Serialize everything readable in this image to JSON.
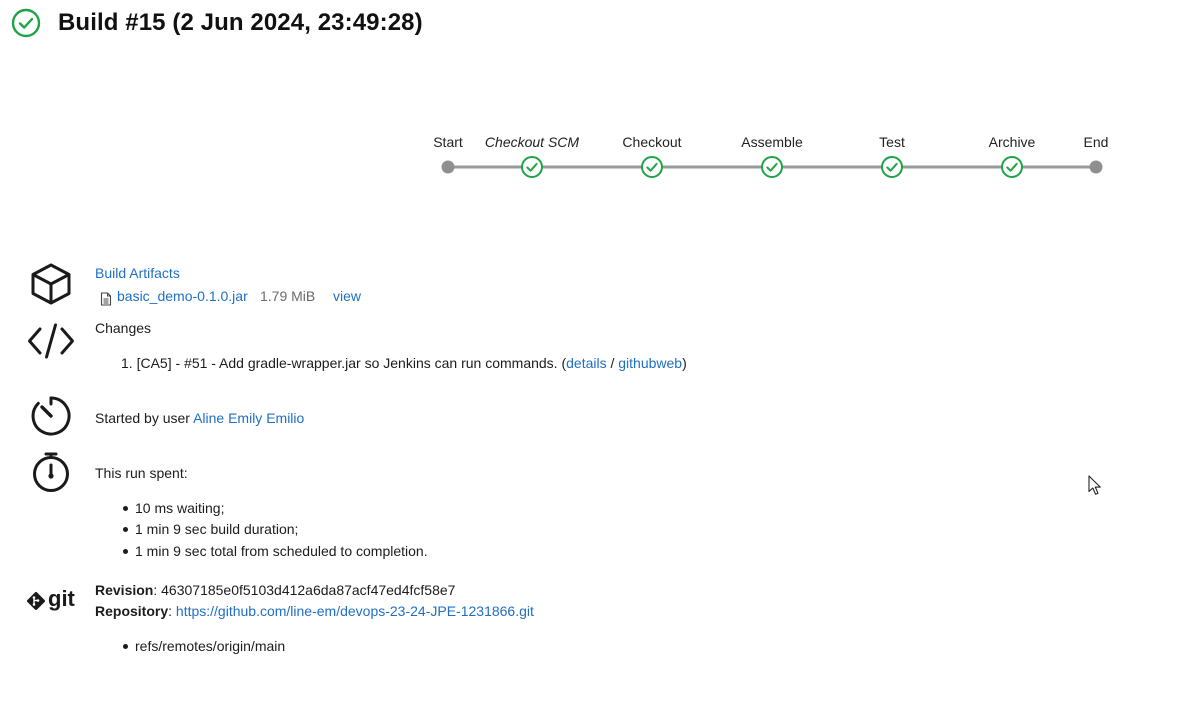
{
  "header": {
    "title": "Build #15 (2 Jun 2024, 23:49:28)",
    "status": "success",
    "status_icon": "check-circle-icon",
    "success_color": "#1ea446"
  },
  "pipeline": {
    "stages": [
      {
        "label": "Start",
        "type": "terminal",
        "italic": false
      },
      {
        "label": "Checkout SCM",
        "type": "success",
        "italic": true
      },
      {
        "label": "Checkout",
        "type": "success",
        "italic": false
      },
      {
        "label": "Assemble",
        "type": "success",
        "italic": false
      },
      {
        "label": "Test",
        "type": "success",
        "italic": false
      },
      {
        "label": "Archive",
        "type": "success",
        "italic": false
      },
      {
        "label": "End",
        "type": "terminal",
        "italic": false
      }
    ]
  },
  "artifacts": {
    "icon": "package-icon",
    "title": "Build Artifacts",
    "files": [
      {
        "name": "basic_demo-0.1.0.jar",
        "size": "1.79 MiB",
        "view_label": "view",
        "icon": "file-icon"
      }
    ]
  },
  "changes": {
    "icon": "code-icon",
    "title": "Changes",
    "items": [
      {
        "number": "1.",
        "text": "[CA5] - #51 - Add gradle-wrapper.jar so Jenkins can run commands. (",
        "details_label": "details",
        "separator": " / ",
        "githubweb_label": "githubweb",
        "closing": ")"
      }
    ]
  },
  "started": {
    "icon": "timer-icon",
    "prefix": "Started by user ",
    "user": "Aline Emily Emilio"
  },
  "timing": {
    "icon": "stopwatch-icon",
    "title": "This run spent:",
    "items": [
      "10 ms waiting;",
      "1 min 9 sec build duration;",
      "1 min 9 sec total from scheduled to completion."
    ]
  },
  "git": {
    "icon": "git-icon",
    "logo_text": "git",
    "revision_label": "Revision",
    "revision": "46307185e0f5103d412a6da87acf47ed4fcf58e7",
    "repository_label": "Repository",
    "repository": "https://github.com/line-em/devops-23-24-JPE-1231866.git",
    "refs": [
      "refs/remotes/origin/main"
    ]
  },
  "cursor": {
    "icon": "mouse-pointer-icon"
  }
}
